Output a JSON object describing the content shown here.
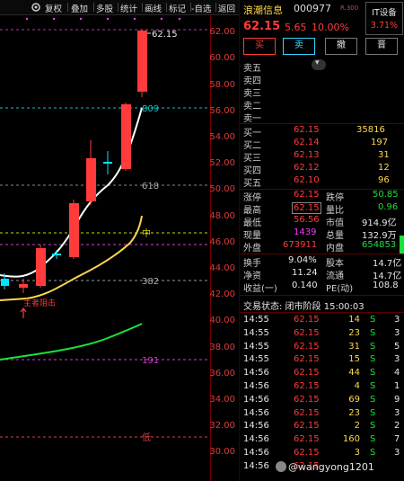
{
  "toolbar": {
    "items": [
      "复权",
      "叠加",
      "多股",
      "统计",
      "画线",
      "标记",
      "-自选",
      "返回"
    ],
    "gear_icon": "gear-icon"
  },
  "chart": {
    "max_label": "62.15",
    "price_ticks": [
      "62.00",
      "60.00",
      "58.00",
      "56.00",
      "54.00",
      "52.00",
      "50.00",
      "48.00",
      "46.00",
      "44.00",
      "42.00",
      "40.00",
      "38.00",
      "36.00",
      "34.00",
      "32.00",
      "30.00"
    ],
    "level_labels": {
      "l809": "809",
      "l618": "618",
      "l500": "中",
      "l382": "382",
      "l191": "191",
      "low": "低"
    },
    "annotation": "主者阻击",
    "colors": {
      "up": "#ff3b3b",
      "down": "#00e5ff",
      "ma5": "#ffffff",
      "ma10": "#ffd84a",
      "ma20": "#19e23c"
    }
  },
  "header": {
    "name": "浪潮信息",
    "code": "000977",
    "suffix": "R.300",
    "sector_name": "IT设备",
    "sector_pct": "3.71%",
    "price": "62.15",
    "change": "5.65",
    "change_pct": "10.00%"
  },
  "buttons": [
    "买",
    "卖",
    "撤",
    "晋"
  ],
  "asks": [
    "卖五",
    "卖四",
    "卖三",
    "卖二",
    "卖一"
  ],
  "bids": [
    {
      "label": "买一",
      "price": "62.15",
      "vol": "35816"
    },
    {
      "label": "买二",
      "price": "62.14",
      "vol": "197"
    },
    {
      "label": "买三",
      "price": "62.13",
      "vol": "31"
    },
    {
      "label": "买四",
      "price": "62.12",
      "vol": "12"
    },
    {
      "label": "买五",
      "price": "62.10",
      "vol": "96"
    }
  ],
  "stats": [
    {
      "l1": "涨停",
      "v1": "62.15",
      "c1": "red",
      "l2": "跌停",
      "v2": "50.85",
      "c2": "green"
    },
    {
      "l1": "最高",
      "v1": "62.15",
      "c1": "red",
      "l2": "量比",
      "v2": "0.96",
      "c2": "green"
    },
    {
      "l1": "最低",
      "v1": "56.56",
      "c1": "red",
      "l2": "市值",
      "v2": "914.9亿",
      "c2": "white"
    },
    {
      "l1": "现量",
      "v1": "1439",
      "c1": "purple",
      "l2": "总量",
      "v2": "132.9万",
      "c2": "white"
    },
    {
      "l1": "外盘",
      "v1": "673911",
      "c1": "red",
      "l2": "内盘",
      "v2": "654853",
      "c2": "green"
    }
  ],
  "stats2": [
    {
      "l1": "换手",
      "v1": "9.04%",
      "l2": "股本",
      "v2": "14.7亿"
    },
    {
      "l1": "净资",
      "v1": "11.24",
      "l2": "流通",
      "v2": "14.7亿"
    },
    {
      "l1": "收益(一)",
      "v1": "0.140",
      "l2": "PE(动)",
      "v2": "108.8"
    }
  ],
  "trade_status": "交易状态: 闭市阶段 15:00:03",
  "ticks": [
    {
      "t": "14:55",
      "p": "62.15",
      "v": "14",
      "s": "S",
      "n": "3"
    },
    {
      "t": "14:55",
      "p": "62.15",
      "v": "23",
      "s": "S",
      "n": "3"
    },
    {
      "t": "14:55",
      "p": "62.15",
      "v": "31",
      "s": "S",
      "n": "5"
    },
    {
      "t": "14:55",
      "p": "62.15",
      "v": "15",
      "s": "S",
      "n": "3"
    },
    {
      "t": "14:56",
      "p": "62.15",
      "v": "44",
      "s": "S",
      "n": "4"
    },
    {
      "t": "14:56",
      "p": "62.15",
      "v": "4",
      "s": "S",
      "n": "1"
    },
    {
      "t": "14:56",
      "p": "62.15",
      "v": "69",
      "s": "S",
      "n": "9"
    },
    {
      "t": "14:56",
      "p": "62.15",
      "v": "23",
      "s": "S",
      "n": "3"
    },
    {
      "t": "14:56",
      "p": "62.15",
      "v": "2",
      "s": "S",
      "n": "2"
    },
    {
      "t": "14:56",
      "p": "62.15",
      "v": "160",
      "s": "S",
      "n": "7"
    },
    {
      "t": "14:56",
      "p": "62.15",
      "v": "3",
      "s": "S",
      "n": "3"
    },
    {
      "t": "14:56",
      "p": "62.15",
      "v": "",
      "s": "",
      "n": ""
    }
  ],
  "watermark": "@wangyong1201"
}
